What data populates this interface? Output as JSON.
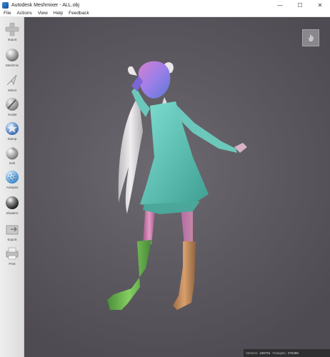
{
  "window": {
    "title": "Autodesk Meshmixer - ALL.obj",
    "minimize_glyph": "—",
    "maximize_glyph": "☐",
    "close_glyph": "✕"
  },
  "menu": {
    "file": "File",
    "actions": "Actions",
    "view": "View",
    "help": "Help",
    "feedback": "Feedback"
  },
  "toolbar": {
    "tools": [
      {
        "label": "Import",
        "icon": "plus-icon"
      },
      {
        "label": "Meshmix",
        "icon": "sphere-icon"
      },
      {
        "label": "Select",
        "icon": "select-arrow-icon"
      },
      {
        "label": "Sculpt",
        "icon": "brush-icon"
      },
      {
        "label": "Stamp",
        "icon": "stamp-icon"
      },
      {
        "label": "Edit",
        "icon": "edit-icon"
      },
      {
        "label": "Analysis",
        "icon": "analysis-icon"
      },
      {
        "label": "Shaders",
        "icon": "shader-ball-icon"
      },
      {
        "label": "Export",
        "icon": "export-icon"
      },
      {
        "label": "Print",
        "icon": "printer-icon"
      }
    ]
  },
  "status": {
    "vertices_label": "Vertices:",
    "vertices_value": "188794",
    "triangles_label": "Triangles:",
    "triangles_value": "375488"
  },
  "colors": {
    "viewport_bg": "#5c585f",
    "hair": "#e3e1e3",
    "dress": "#6fd1c3",
    "head": "#9b7fe8",
    "leg_pink": "#d889b8",
    "boot_green": "#6fba52",
    "boot_orange": "#c98f5c"
  }
}
